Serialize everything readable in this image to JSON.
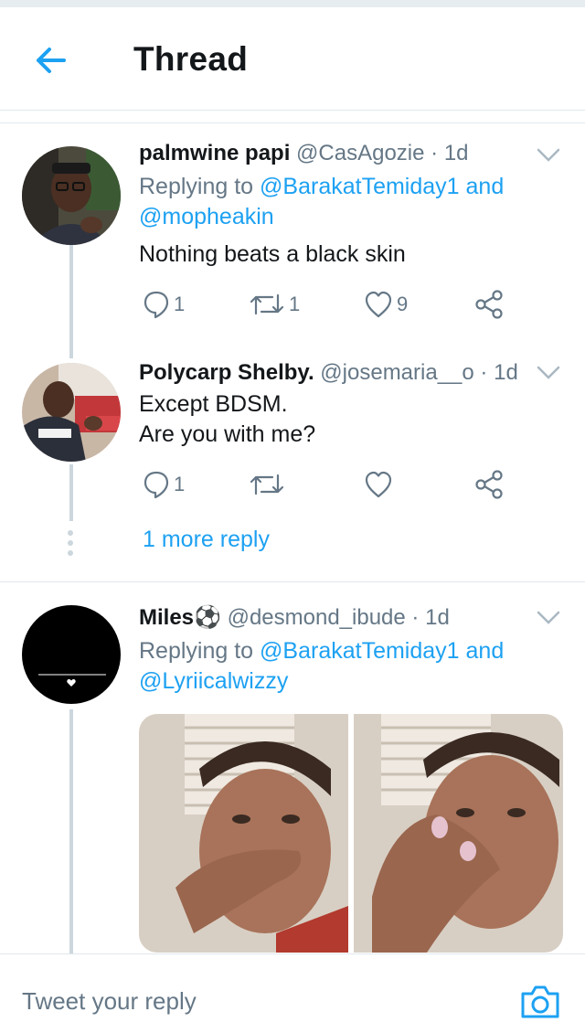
{
  "header": {
    "title": "Thread",
    "back_icon": "arrow-left-icon",
    "accent": "#1da1f2"
  },
  "tweets": [
    {
      "name": "palmwine papi",
      "handle": "@CasAgozie",
      "dot": "·",
      "time": "1d",
      "replying_prefix": "Replying to",
      "replying_users": [
        "@BarakatTemiday1",
        "@mopheakin"
      ],
      "replying_joiner": "and",
      "text_lines": [
        "Nothing beats a black skin"
      ],
      "reply_count": "1",
      "retweet_count": "1",
      "like_count": "9"
    },
    {
      "name": "Polycarp Shelby.",
      "handle": "@josemaria__o",
      "dot": "·",
      "time": "1d",
      "text_lines": [
        "Except BDSM.",
        "Are you with me?"
      ],
      "reply_count": "1",
      "retweet_count": "",
      "like_count": ""
    },
    {
      "name": "Miles⚽",
      "handle": "@desmond_ibude",
      "dot": "·",
      "time": "1d",
      "replying_prefix": "Replying to",
      "replying_users": [
        "@BarakatTemiday1",
        "@Lyriicalwizzy"
      ],
      "replying_joiner": "and"
    }
  ],
  "more_replies": "1 more reply",
  "reply_bar": {
    "placeholder": "Tweet your reply",
    "camera_icon": "camera-icon"
  }
}
